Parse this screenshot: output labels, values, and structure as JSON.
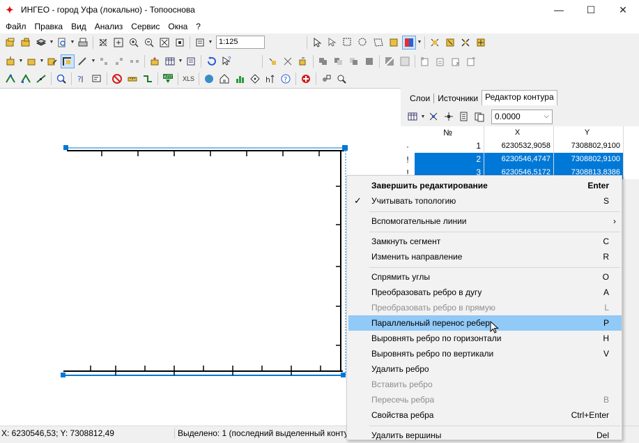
{
  "window": {
    "title": "ИНГЕО - город Уфа (локально) - Топооснова",
    "icon": "ingeo-app-icon",
    "controls": {
      "minimize": "—",
      "maximize": "☐",
      "close": "✕"
    }
  },
  "menu": [
    "Файл",
    "Правка",
    "Вид",
    "Анализ",
    "Сервис",
    "Окна",
    "?"
  ],
  "toolbar": {
    "scale_value": "1:125",
    "xls_label": "XLS",
    "kpt_label": "КПТ",
    "colors": {
      "accent_blue": "#0078d7",
      "highlight": "#91c9f7"
    }
  },
  "panel": {
    "tabs": [
      "Слои",
      "Источники",
      "Редактор контура"
    ],
    "active_tab": "Редактор контура",
    "coord_value": "0.0000",
    "grid": {
      "headers": [
        "№",
        "X",
        "Y"
      ],
      "rows": [
        {
          "n": "1",
          "x": "6230532,9058",
          "y": "7308802,9100",
          "selected": false
        },
        {
          "n": "2",
          "x": "6230546,4747",
          "y": "7308802,9100",
          "selected": true
        },
        {
          "n": "3",
          "x": "6230546,5172",
          "y": "7308813,8386",
          "selected": true
        }
      ]
    }
  },
  "context_menu": {
    "items": [
      {
        "label": "Завершить редактирование",
        "shortcut": "Enter",
        "bold": true
      },
      {
        "label": "Учитывать топологию",
        "shortcut": "S",
        "checked": true
      },
      {
        "label": "Вспомогательные линии",
        "submenu": "›"
      },
      {
        "label": "Замкнуть сегмент",
        "shortcut": "C"
      },
      {
        "label": "Изменить направление",
        "shortcut": "R"
      },
      {
        "label": "Спрямить углы",
        "shortcut": "O"
      },
      {
        "label": "Преобразовать ребро в дугу",
        "shortcut": "A"
      },
      {
        "label": "Преобразовать ребро в прямую",
        "shortcut": "L",
        "disabled": true
      },
      {
        "label": "Параллельный перенос ребер",
        "shortcut": "P",
        "highlighted": true
      },
      {
        "label": "Выровнять ребро по горизонтали",
        "shortcut": "H"
      },
      {
        "label": "Выровнять ребро по вертикали",
        "shortcut": "V"
      },
      {
        "label": "Удалить ребро",
        "shortcut": ""
      },
      {
        "label": "Вставить ребро",
        "shortcut": "",
        "disabled": true
      },
      {
        "label": "Пересечь ребра",
        "shortcut": "B",
        "disabled": true
      },
      {
        "label": "Свойства ребра",
        "shortcut": "Ctrl+Enter"
      },
      {
        "label": "Удалить вершины",
        "shortcut": "Del"
      }
    ]
  },
  "status": {
    "coords": "X: 6230546,53; Y: 7308812,49",
    "selection": "Выделено: 1 (последний выделенный контур"
  }
}
